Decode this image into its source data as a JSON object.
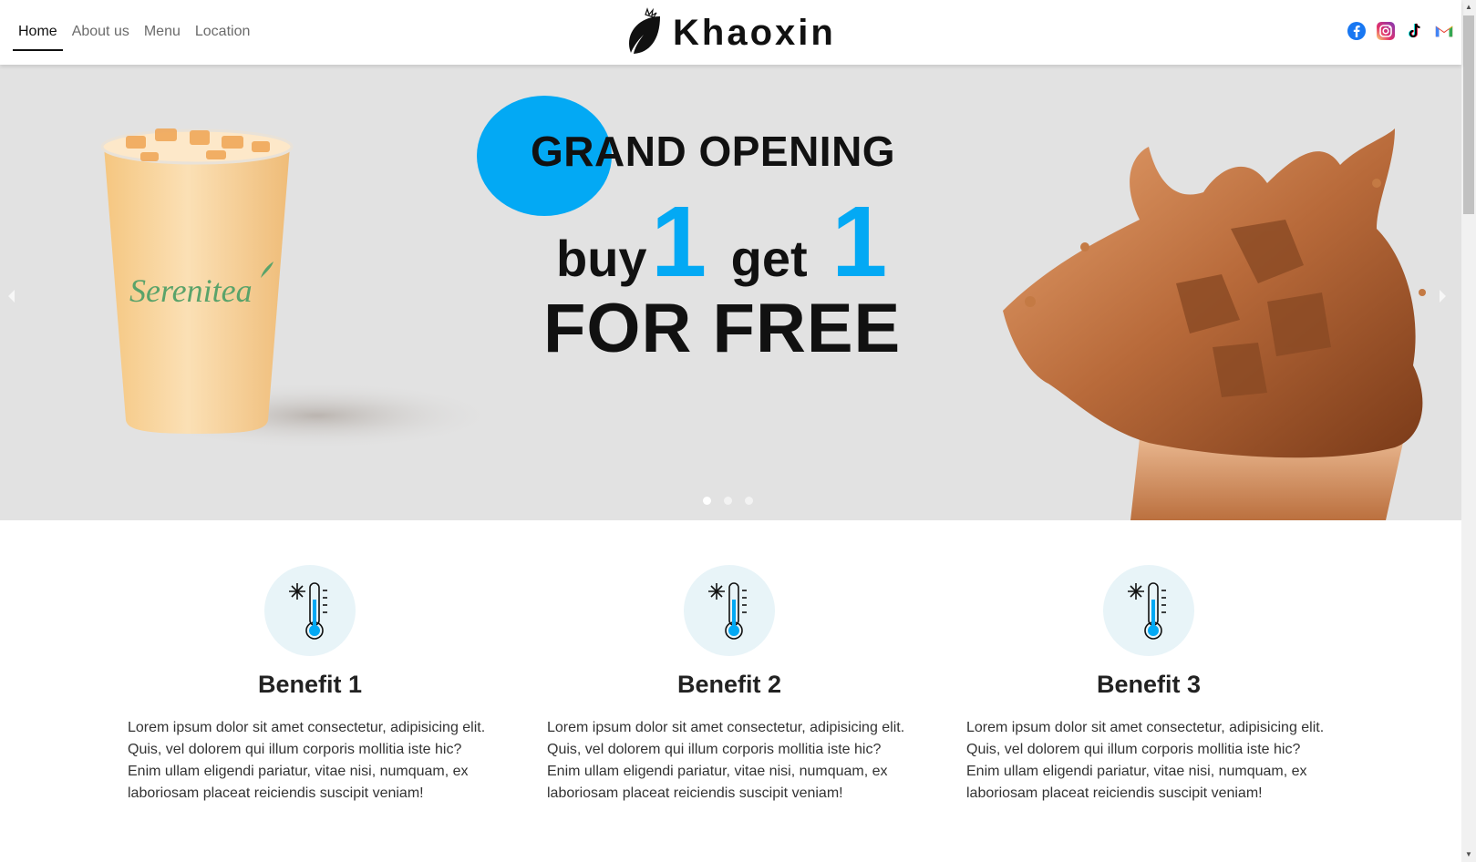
{
  "nav": {
    "items": [
      {
        "label": "Home",
        "active": true
      },
      {
        "label": "About us",
        "active": false
      },
      {
        "label": "Menu",
        "active": false
      },
      {
        "label": "Location",
        "active": false
      }
    ]
  },
  "brand": {
    "name": "Khaoxin",
    "logo_icon": "leaf-icon"
  },
  "socials": [
    {
      "name": "facebook-icon",
      "color": "#1877f2"
    },
    {
      "name": "instagram-icon",
      "color": "#e1306c"
    },
    {
      "name": "tiktok-icon",
      "color": "#000000"
    },
    {
      "name": "gmail-icon",
      "color": "#ea4335"
    }
  ],
  "hero": {
    "title": "GRAND OPENING",
    "promo_buy": "buy",
    "promo_num1": "1",
    "promo_get": "get",
    "promo_num2": "1",
    "subtitle": "FOR FREE",
    "cup_brand": "Serenitea",
    "accent_color": "#03a9f4",
    "slides": 3,
    "active_slide": 1
  },
  "benefits": [
    {
      "title": "Benefit 1",
      "icon": "thermometer-cold-icon",
      "text": "Lorem ipsum dolor sit amet consectetur, adipisicing elit. Quis, vel dolorem qui illum corporis mollitia iste hic? Enim ullam eligendi pariatur, vitae nisi, numquam, ex laboriosam placeat reiciendis suscipit veniam!"
    },
    {
      "title": "Benefit 2",
      "icon": "thermometer-cold-icon",
      "text": "Lorem ipsum dolor sit amet consectetur, adipisicing elit. Quis, vel dolorem qui illum corporis mollitia iste hic? Enim ullam eligendi pariatur, vitae nisi, numquam, ex laboriosam placeat reiciendis suscipit veniam!"
    },
    {
      "title": "Benefit 3",
      "icon": "thermometer-cold-icon",
      "text": "Lorem ipsum dolor sit amet consectetur, adipisicing elit. Quis, vel dolorem qui illum corporis mollitia iste hic? Enim ullam eligendi pariatur, vitae nisi, numquam, ex laboriosam placeat reiciendis suscipit veniam!"
    }
  ]
}
